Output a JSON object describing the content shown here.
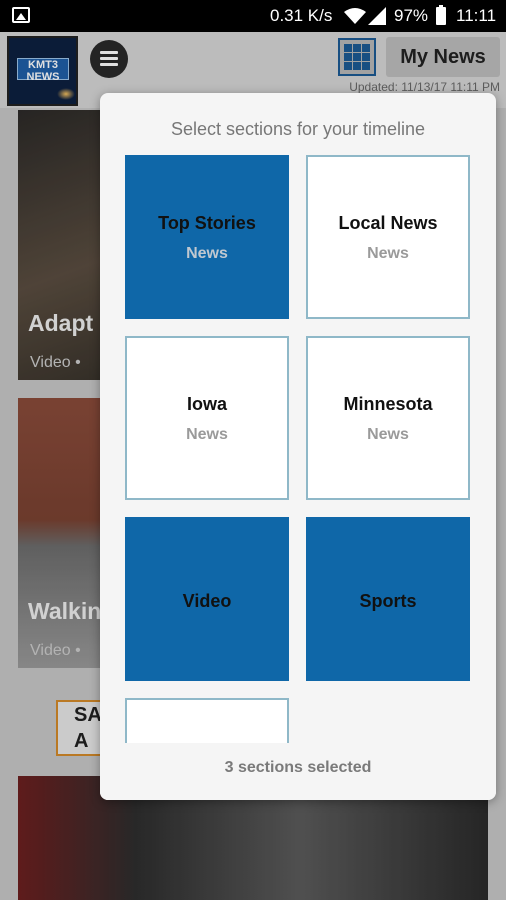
{
  "status_bar": {
    "speed": "0.31 K/s",
    "battery": "97%",
    "time": "11:11",
    "icons": [
      "image-notification-icon",
      "wifi-icon",
      "signal-icon",
      "battery-icon"
    ]
  },
  "header": {
    "logo_text": "KMT3 NEWS",
    "updated": "Updated: 11/13/17 11:11 PM",
    "my_news_label": "My News"
  },
  "background_cards": [
    {
      "title": "Adapt",
      "meta": "Video •"
    },
    {
      "title": "Walkin",
      "meta": "Video •"
    }
  ],
  "banner_text": "SA A",
  "dialog": {
    "title": "Select sections for your timeline",
    "sections": [
      {
        "label": "Top Stories",
        "sub": "News",
        "selected": true
      },
      {
        "label": "Local News",
        "sub": "News",
        "selected": false
      },
      {
        "label": "Iowa",
        "sub": "News",
        "selected": false
      },
      {
        "label": "Minnesota",
        "sub": "News",
        "selected": false
      },
      {
        "label": "Video",
        "sub": "",
        "selected": true
      },
      {
        "label": "Sports",
        "sub": "",
        "selected": true
      },
      {
        "label": "",
        "sub": "",
        "selected": false
      }
    ],
    "footer": "3 sections selected"
  },
  "colors": {
    "accent": "#0f67a8",
    "tile_border": "#8fb8c8"
  }
}
